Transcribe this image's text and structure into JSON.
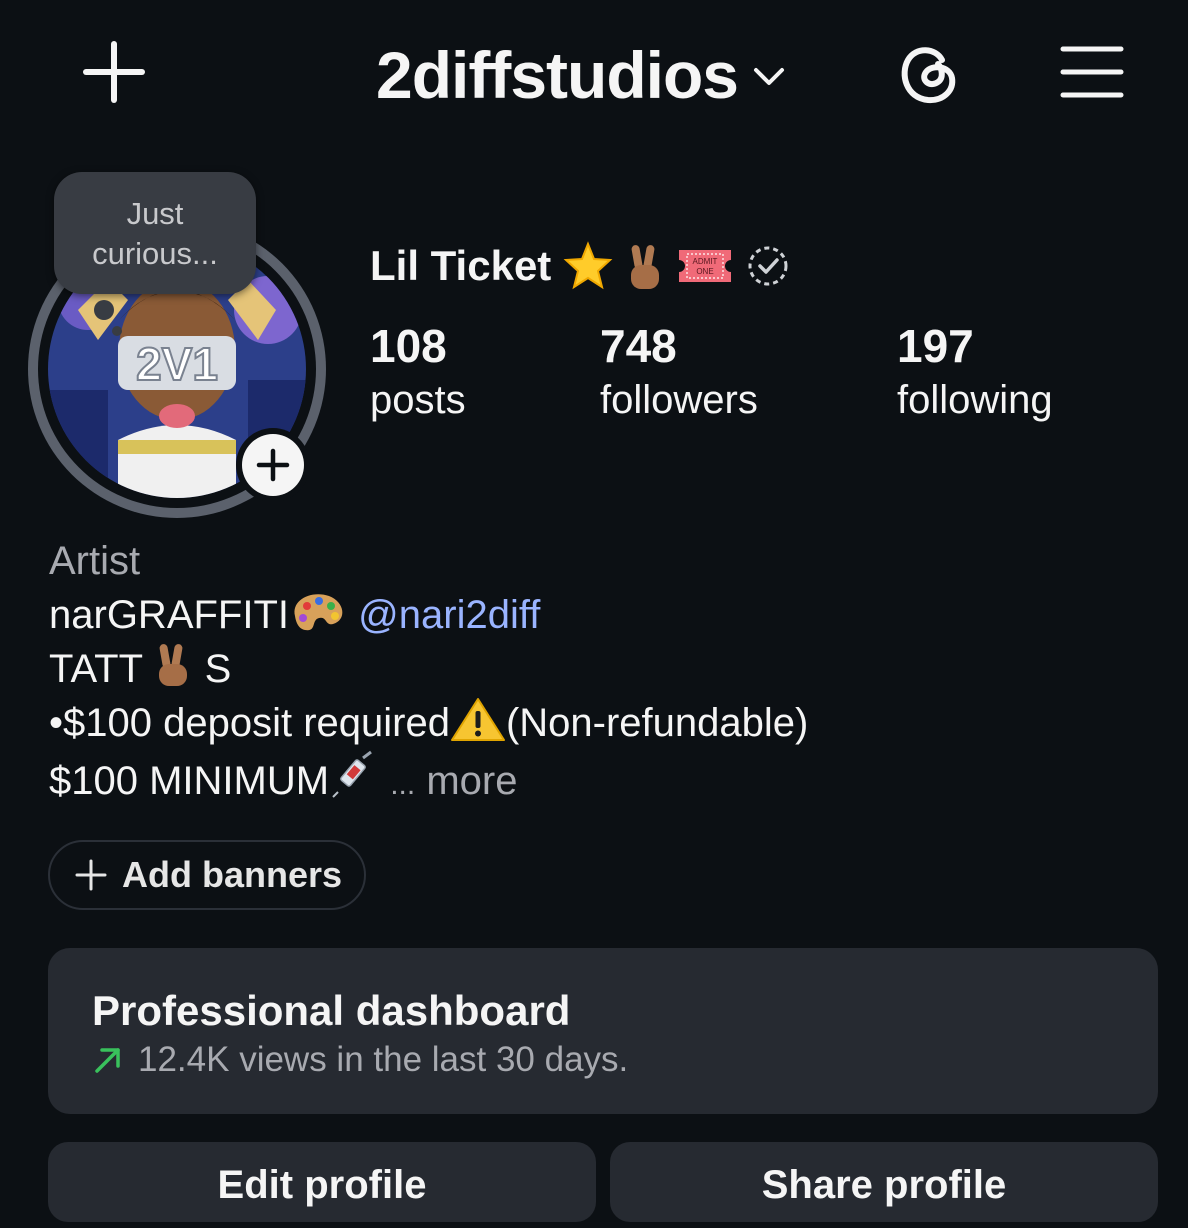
{
  "header": {
    "username": "2diffstudios",
    "icons": [
      "plus-icon",
      "chevron-down-icon",
      "threads-icon",
      "menu-icon"
    ]
  },
  "note": {
    "text_line1": "Just",
    "text_line2": "curious..."
  },
  "profile": {
    "display_name": "Lil Ticket",
    "name_emojis": [
      "star",
      "victory-hand",
      "admit-one-ticket",
      "verified-badge-dashed"
    ],
    "ticket_text": "ADMIT ONE"
  },
  "stats": [
    {
      "value": "108",
      "label": "posts"
    },
    {
      "value": "748",
      "label": "followers"
    },
    {
      "value": "197",
      "label": "following"
    }
  ],
  "bio": {
    "category": "Artist",
    "line1_text": "narGRAFFITI",
    "line1_mention": "@nari2diff",
    "line2_a": "TATT",
    "line2_b": "S",
    "line3_a": "•$100 deposit required",
    "line3_b": "(Non-refundable)",
    "line4": "$100 MINIMUM",
    "ellipsis": "...",
    "more": "more"
  },
  "add_banners": {
    "label": "Add banners"
  },
  "dashboard": {
    "title": "Professional dashboard",
    "subtitle": "12.4K views in the last 30 days.",
    "trend_color": "#39c15c"
  },
  "buttons": {
    "edit_profile": "Edit profile",
    "share_profile": "Share profile"
  },
  "colors": {
    "background": "#0c1014",
    "mention": "#9ab4ff",
    "card": "#262a31"
  }
}
